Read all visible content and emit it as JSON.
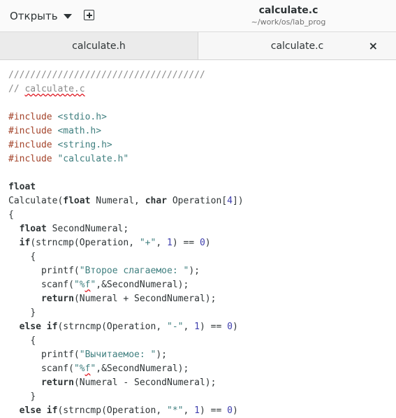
{
  "header": {
    "open_label": "Открыть",
    "title": "calculate.c",
    "subtitle": "~/work/os/lab_prog"
  },
  "tabs": [
    {
      "label": "calculate.h",
      "active": false
    },
    {
      "label": "calculate.c",
      "active": true
    }
  ],
  "code": {
    "l1": "////////////////////////////////////",
    "l2_prefix": "// ",
    "l2_word": "calculate.c",
    "inc": "#include",
    "inc1": "<stdio.h>",
    "inc2": "<math.h>",
    "inc3": "<string.h>",
    "inc4": "\"calculate.h\"",
    "kw_float": "float",
    "kw_char": "char",
    "kw_if": "if",
    "kw_else": "else",
    "kw_return": "return",
    "calc_name": "Calculate(",
    "param1": " Numeral, ",
    "param2": " Operation[",
    "num4": "4",
    "close_paren": "])",
    "brace_open": "{",
    "brace_close": "}",
    "decl_var": " SecondNumeral;",
    "strncmp_open": "(strncmp(Operation, ",
    "str_plus": "\"+\"",
    "str_minus": "\"-\"",
    "str_mul": "\"*\"",
    "comma_sep": ", ",
    "num1": "1",
    "eq_part": ") == ",
    "num0": "0",
    "paren_close": ")",
    "printf_open": "printf(",
    "str_add": "\"Второе слагаемое: \"",
    "str_sub": "\"Вычитаемое: \"",
    "stmt_end": ");",
    "scanf_open": "scanf(",
    "quote": "\"",
    "pct": "%",
    "fmt_f": "f",
    "scanf_args": ",&SecondNumeral);",
    "ret_add": "(Numeral + SecondNumeral);",
    "ret_sub": "(Numeral - SecondNumeral);"
  },
  "colors": {
    "preprocessor": "#a3432a",
    "string": "#3f7f7f",
    "number": "#3f3fae",
    "comment": "#8a8a8a"
  }
}
